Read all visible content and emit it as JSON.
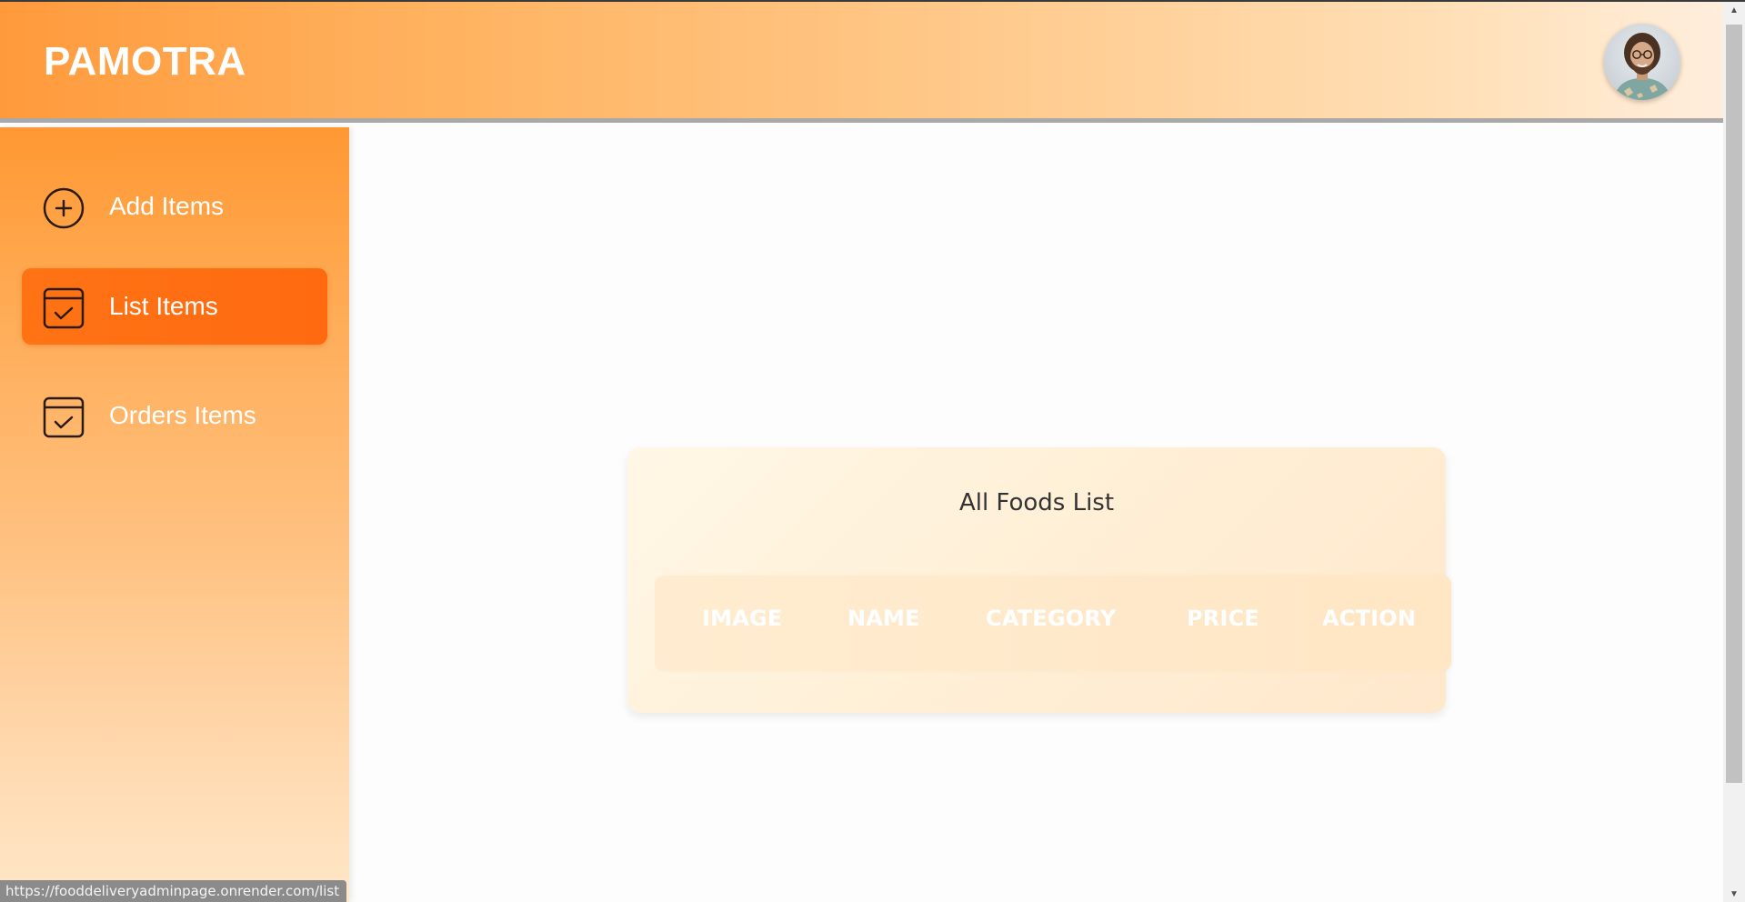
{
  "header": {
    "brand": "PAMOTRA",
    "avatar_alt": "Profile"
  },
  "sidebar": {
    "items": [
      {
        "label": "Add Items",
        "icon": "plus-circle-icon",
        "active": false
      },
      {
        "label": "List Items",
        "icon": "calendar-check-icon",
        "active": true
      },
      {
        "label": "Orders Items",
        "icon": "calendar-check-icon",
        "active": false
      }
    ]
  },
  "main": {
    "title": "All Foods List",
    "columns": [
      "IMAGE",
      "NAME",
      "CATEGORY",
      "PRICE",
      "ACTION"
    ]
  },
  "status_bar": {
    "url": "https://fooddeliveryadminpage.onrender.com/list"
  },
  "colors": {
    "accent": "#ff6a10",
    "header_start": "#ff9a3c",
    "header_end": "#ffeedd"
  }
}
